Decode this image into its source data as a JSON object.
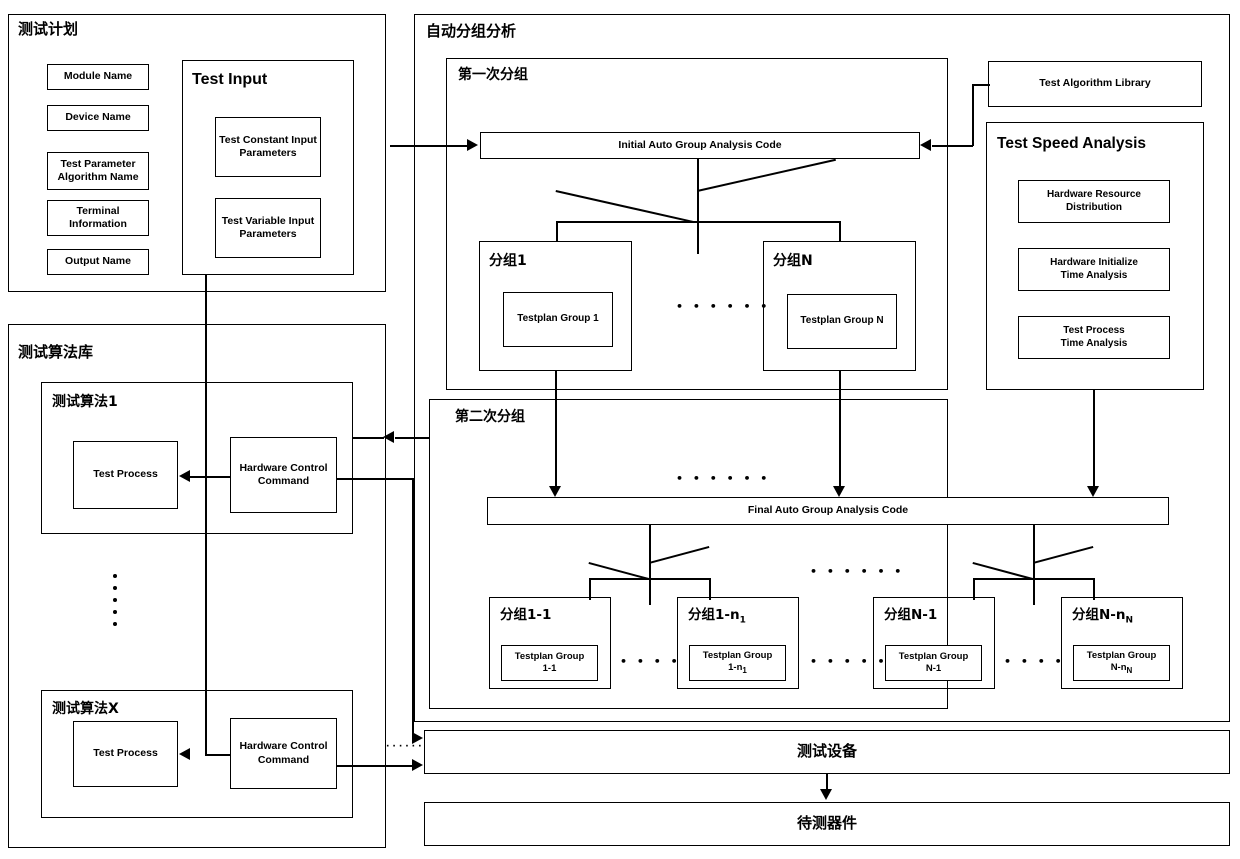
{
  "diagram": {
    "title_note": "Automatic grouping analysis architecture block diagram"
  },
  "test_plan": {
    "title": "测试计划",
    "fields": [
      "Module Name",
      "Device Name",
      "Test Parameter\nAlgorithm Name",
      "Terminal\nInformation",
      "Output Name"
    ],
    "field_labels": {
      "module_name": "Module Name",
      "device_name": "Device Name",
      "test_parameter_algorithm_name": "Test Parameter Algorithm Name",
      "terminal_information": "Terminal Information",
      "output_name": "Output Name"
    },
    "test_input": {
      "title": "Test Input",
      "items": [
        "Test Constant Input Parameters",
        "Test Variable Input Parameters"
      ],
      "item_constant": "Test Constant Input Parameters",
      "item_variable": "Test Variable Input Parameters"
    }
  },
  "algorithm_library": {
    "title": "测试算法库",
    "algorithms": [
      {
        "title": "测试算法1",
        "test_process": "Test Process",
        "hardware_control_command": "Hardware Control Command"
      },
      {
        "title": "测试算法X",
        "test_process": "Test Process",
        "hardware_control_command": "Hardware Control Command"
      }
    ],
    "ellipsis": "vertical-dots"
  },
  "auto_group_analysis": {
    "title": "自动分组分析",
    "first_grouping": {
      "title": "第一次分组",
      "code_box": "Initial Auto Group Analysis Code",
      "groups": [
        {
          "title": "分组1",
          "testplan": "Testplan Group 1"
        },
        {
          "title": "分组N",
          "testplan": "Testplan Group N"
        }
      ],
      "ellipsis": "• • • • • •"
    },
    "second_grouping": {
      "title": "第二次分组",
      "code_box": "Final Auto Group Analysis Code",
      "top_ellipsis": "• • • • • •",
      "groups": [
        {
          "title_prefix": "分组1-1",
          "testplan_l1": "Testplan Group",
          "testplan_l2": "1-1"
        },
        {
          "title_prefix": "分组1-n",
          "title_sub": "1",
          "testplan_l1": "Testplan Group",
          "testplan_l2": "1-n",
          "testplan_sub": "1"
        },
        {
          "title_prefix": "分组N-1",
          "testplan_l1": "Testplan Group",
          "testplan_l2": "N-1"
        },
        {
          "title_prefix": "分组N-n",
          "title_sub": "N",
          "testplan_l1": "Testplan Group",
          "testplan_l2": "N-n",
          "testplan_sub": "N"
        }
      ],
      "ellipsis": "• • • • • •"
    }
  },
  "right_column": {
    "test_algorithm_library": "Test Algorithm Library",
    "test_speed_analysis": {
      "title": "Test Speed Analysis",
      "items": [
        "Hardware Resource Distribution",
        "Hardware Initialize Time Analysis",
        "Test Process Time Analysis"
      ],
      "item_1_l1": "Hardware Resource",
      "item_1_l2": "Distribution",
      "item_2_l1": "Hardware Initialize",
      "item_2_l2": "Time Analysis",
      "item_3_l1": "Test Process",
      "item_3_l2": "Time Analysis"
    }
  },
  "bottom": {
    "test_equipment": "测试设备",
    "device_under_test": "待测器件",
    "equipment_ellipsis": "······"
  },
  "colors": {
    "stroke": "#000000",
    "background": "#ffffff"
  }
}
